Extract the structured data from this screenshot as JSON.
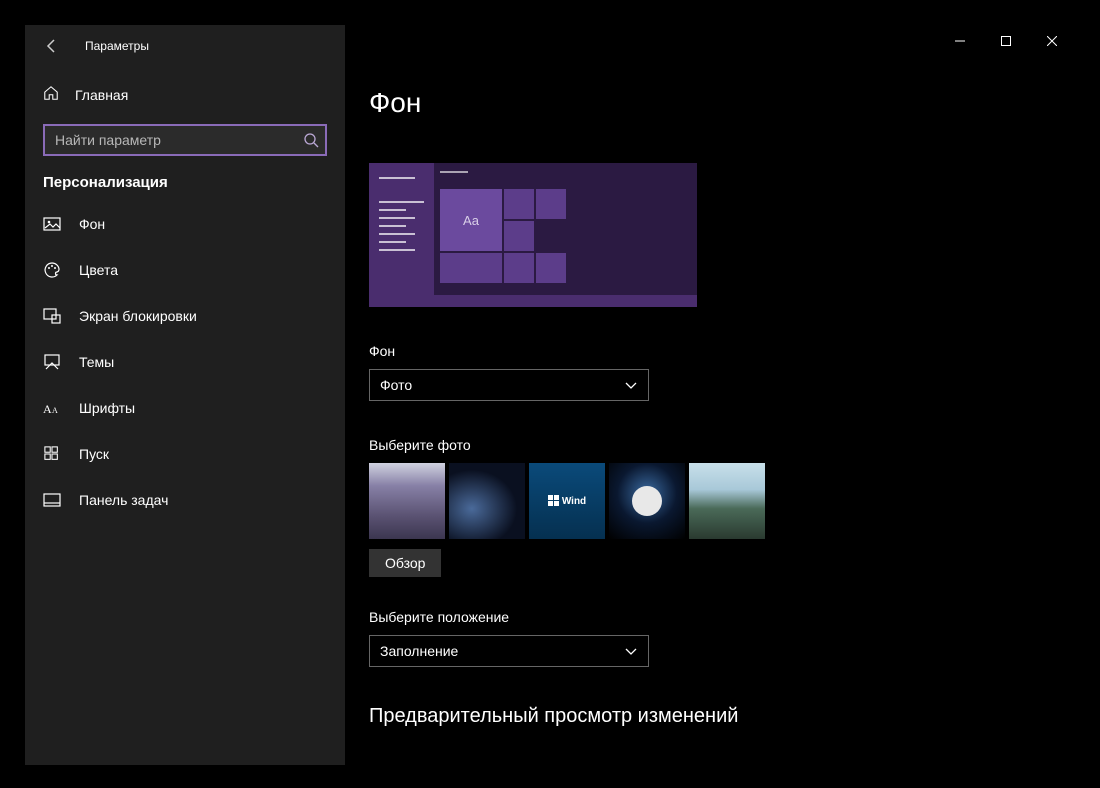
{
  "header": {
    "app_title": "Параметры"
  },
  "sidebar": {
    "home_label": "Главная",
    "search_placeholder": "Найти параметр",
    "category": "Персонализация",
    "items": [
      {
        "label": "Фон"
      },
      {
        "label": "Цвета"
      },
      {
        "label": "Экран блокировки"
      },
      {
        "label": "Темы"
      },
      {
        "label": "Шрифты"
      },
      {
        "label": "Пуск"
      },
      {
        "label": "Панель задач"
      }
    ]
  },
  "page": {
    "title": "Фон",
    "preview_sample": "Aa",
    "background_label": "Фон",
    "background_dropdown": "Фото",
    "choose_photo_label": "Выберите фото",
    "win_tile_text": "Wind",
    "browse_button": "Обзор",
    "position_label": "Выберите положение",
    "position_dropdown": "Заполнение",
    "preview_heading": "Предварительный просмотр изменений"
  }
}
